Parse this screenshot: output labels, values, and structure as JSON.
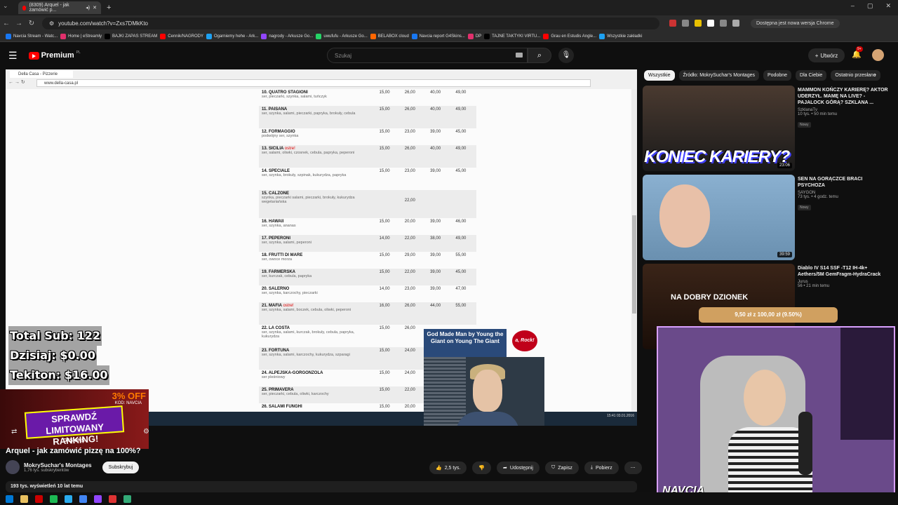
{
  "browser": {
    "tab_title": "(8309) Arquel - jak zamówić p...",
    "url": "youtube.com/watch?v=Zxs7DMkKto",
    "update_label": "Dostępna jest nowa wersja Chrome",
    "bookmarks": [
      "Navcia Stream - Watc...",
      "Home | eStreamly",
      "BAJKI ZAPAS STREAM",
      "Cennik/NAGRODY",
      "Ogarniemy hehe - Ark...",
      "nagrody - Arkusze Go...",
      "uwufufu - Arkusze Go...",
      "BELABOX cloud",
      "Navcia report G4Skins...",
      "DP",
      "TAJNE TAKTYKI VIRTU...",
      "Grau en Estudis Angle...",
      "Wszystkie zakładki"
    ],
    "bookmark_colors": [
      "#1877f2",
      "#e1306c",
      "#000000",
      "#ff0000",
      "#1da1f2",
      "#9146ff",
      "#25d366",
      "#ff6600"
    ]
  },
  "youtube": {
    "logo_text": "Premium",
    "logo_suffix": "PL",
    "search_placeholder": "Szukaj",
    "create_label": "Utwórz",
    "notification_count": "9+"
  },
  "inner_browser": {
    "tab_title": "Della Casa - Pizzerie",
    "url": "www.della-casa.pl"
  },
  "menu": [
    {
      "name": "10. QUATRO STAGIONI",
      "ing": "ser, pieczarki, szynka, salami, tuńczyk",
      "prices": [
        "15,00",
        "26,00",
        "40,00",
        "49,00"
      ]
    },
    {
      "name": "11. PAISANA",
      "ing": "ser, szynka, salami, pieczarki, papryka, brokuły, cebula",
      "prices": [
        "15,00",
        "26,00",
        "40,00",
        "49,00"
      ]
    },
    {
      "name": "12. FORMAGGIO",
      "ing": "podwójny ser, szynka",
      "prices": [
        "15,00",
        "23,00",
        "39,00",
        "45,00"
      ]
    },
    {
      "name": "13. SICILIA",
      "hot": "ostre!",
      "ing": "ser, salami, oliwki, czosnek, cebula, papryka, peperoni",
      "prices": [
        "15,00",
        "26,00",
        "40,00",
        "49,00"
      ]
    },
    {
      "name": "14. SPECIALE",
      "ing": "ser, szynka, brokuły, szpinak, kukurydza, papryka",
      "prices": [
        "15,00",
        "23,00",
        "39,00",
        "45,00"
      ]
    },
    {
      "name": "15. CALZONE",
      "ing": "szynka, pieczarki salami, pieczarki, brokuły, kukurydza wegetariańska",
      "prices": [
        "",
        "22,00",
        "",
        ""
      ]
    },
    {
      "name": "16. HAWAII",
      "ing": "ser, szynka, ananas",
      "prices": [
        "15,00",
        "20,00",
        "39,00",
        "46,00"
      ]
    },
    {
      "name": "17. PEPERONI",
      "ing": "ser, szynka, salami, peperoni",
      "prices": [
        "14,00",
        "22,00",
        "38,00",
        "49,00"
      ]
    },
    {
      "name": "18. FRUTTI DI MARE",
      "ing": "ser, owoce morza",
      "prices": [
        "15,00",
        "29,00",
        "39,00",
        "55,00"
      ]
    },
    {
      "name": "19. FARMERSKA",
      "ing": "ser, kurczak, cebula, papryka",
      "prices": [
        "15,00",
        "22,00",
        "39,00",
        "45,00"
      ]
    },
    {
      "name": "20. SALERNO",
      "ing": "ser, szynka, karczochy, pieczarki",
      "prices": [
        "14,00",
        "23,00",
        "39,00",
        "47,00"
      ]
    },
    {
      "name": "21. MAFIA",
      "hot": "ostre!",
      "ing": "ser, szynka, salami, boczek, cebula, oliwki, peperoni",
      "prices": [
        "16,00",
        "26,00",
        "44,00",
        "55,00"
      ]
    },
    {
      "name": "22. LA COSTA",
      "ing": "ser, szynka, salami, kurczak, brokuły, cebula, papryka, kukurydza",
      "prices": [
        "15,00",
        "26,00",
        "",
        ""
      ]
    },
    {
      "name": "23. FORTUNA",
      "ing": "ser, szynka, salami, karczochy, kukurydza, szparagi",
      "prices": [
        "15,00",
        "24,00",
        "",
        ""
      ]
    },
    {
      "name": "24. ALPEJSKA-GORGONZOLA",
      "ing": "ser pleśniowy",
      "prices": [
        "15,00",
        "24,00",
        "",
        ""
      ]
    },
    {
      "name": "25. PRIMAVERA",
      "ing": "ser, pieczarki, cebula, oliwki, karczochy",
      "prices": [
        "15,00",
        "22,00",
        "",
        ""
      ]
    },
    {
      "name": "26. SALAMI FUNGHI",
      "ing": "",
      "prices": [
        "15,00",
        "20,00",
        "",
        ""
      ]
    }
  ],
  "overlay": {
    "total_sub": "Total Sub: 122",
    "dzisiaj": "Dzisiaj: $0.00",
    "tekiton": "Tekiton: $16.00",
    "promo_off": "3% OFF",
    "promo_code": "KOD: NAVCIA",
    "promo_rank": "SPRAWDŹ LIMITOWANY RANKING!",
    "promo_brand": "G4SKINS",
    "song": "God Made Man by Young the Giant on Young The Giant",
    "rock": "a, Rock!",
    "clock": "15:41 03.01.2016"
  },
  "video": {
    "title": "Arquel - jak zamówić pizzę na 100%?",
    "channel": "MokrySuchar's Montages",
    "subscribers": "1,76 tys. subskrybentów",
    "subscribe": "Subskrybuj",
    "likes": "2,5 tys.",
    "share": "Udostępnij",
    "save": "Zapisz",
    "download": "Pobierz",
    "meta": "193 tys. wyświetleń  10 lat temu"
  },
  "chips": [
    "Wszystkie",
    "Źródło: MokrySuchar's Montages",
    "Podobne",
    "Dla Ciebie",
    "Ostatnio przesłane"
  ],
  "recommendations": [
    {
      "title": "MAMMON KOŃCZY KARIERĘ? AKTOR UDERZYŁ. MAMĘ NA LIVE? - PAJALOCK GÓRĄ? SZKLANA ...",
      "channel": "SzklanaTv",
      "views": "10 tys. • 50 min temu",
      "badge": "Nowy",
      "overlay": "KONIEC KARIERY?",
      "duration": "23:06"
    },
    {
      "title": "SEN NA GORĄCZCE BRACI PSYCHOZA",
      "channel": "SAYGON",
      "views": "73 tys. • 4 godz. temu",
      "badge": "Nowy",
      "overlay": "",
      "duration": "39:59"
    },
    {
      "title": "Diablo IV S14 SSF -T12 IH-4k+ Aethers/5M GemFragm-HydraCrack",
      "channel": "Jurus",
      "views": "56 • 21 min temu",
      "badge": "",
      "overlay": "NA DOBRY DZIONEK",
      "duration": ""
    }
  ],
  "donation_bar": "9,50 zł z 100,00 zł (9.50%)",
  "streamer_label": "NAVCIA"
}
